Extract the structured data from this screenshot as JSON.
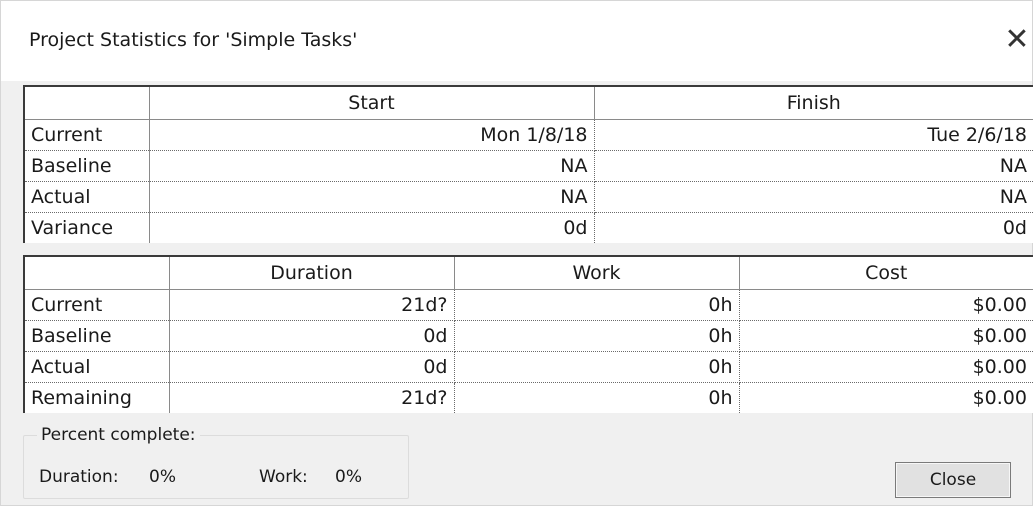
{
  "window": {
    "title": "Project Statistics for 'Simple Tasks'"
  },
  "dates_table": {
    "headers": [
      "Start",
      "Finish"
    ],
    "rows": [
      {
        "label": "Current",
        "start": "Mon 1/8/18",
        "finish": "Tue 2/6/18"
      },
      {
        "label": "Baseline",
        "start": "NA",
        "finish": "NA"
      },
      {
        "label": "Actual",
        "start": "NA",
        "finish": "NA"
      },
      {
        "label": "Variance",
        "start": "0d",
        "finish": "0d"
      }
    ]
  },
  "totals_table": {
    "headers": [
      "Duration",
      "Work",
      "Cost"
    ],
    "rows": [
      {
        "label": "Current",
        "duration": "21d?",
        "work": "0h",
        "cost": "$0.00"
      },
      {
        "label": "Baseline",
        "duration": "0d",
        "work": "0h",
        "cost": "$0.00"
      },
      {
        "label": "Actual",
        "duration": "0d",
        "work": "0h",
        "cost": "$0.00"
      },
      {
        "label": "Remaining",
        "duration": "21d?",
        "work": "0h",
        "cost": "$0.00"
      }
    ]
  },
  "percent_complete": {
    "legend": "Percent complete:",
    "duration_label": "Duration:",
    "duration_value": "0%",
    "work_label": "Work:",
    "work_value": "0%"
  },
  "buttons": {
    "close_label": "Close",
    "close_icon": "close-icon"
  }
}
